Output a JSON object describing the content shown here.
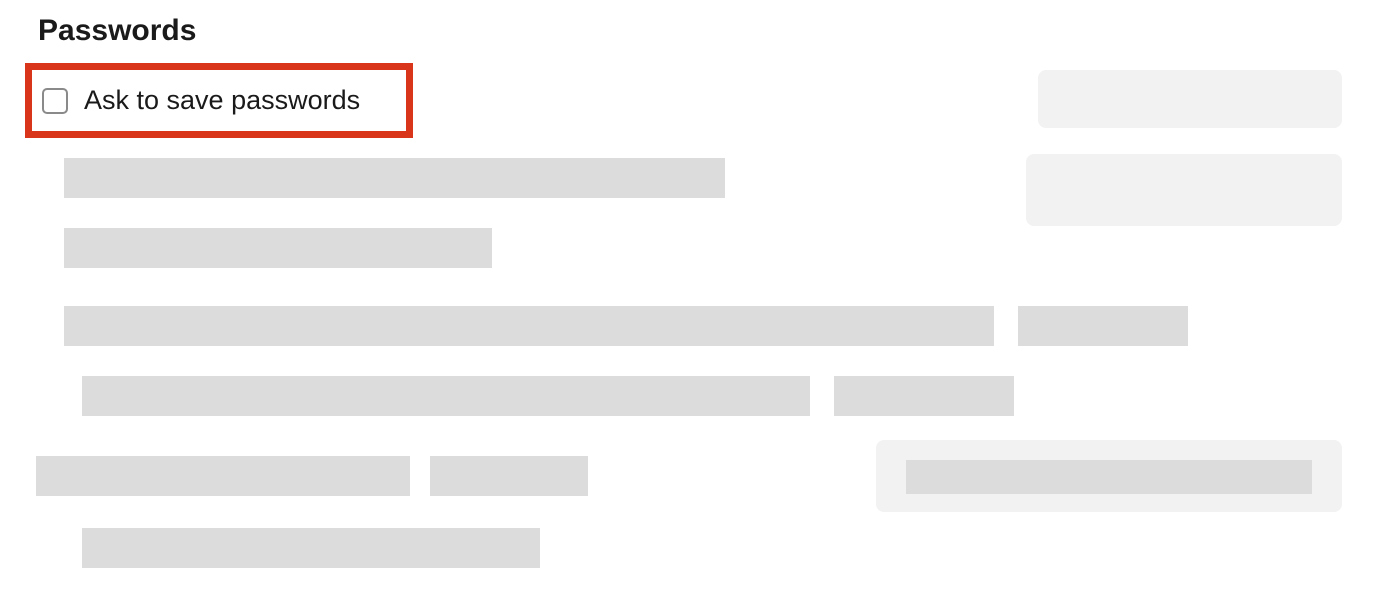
{
  "section": {
    "title": "Passwords"
  },
  "ask_to_save": {
    "label": "Ask to save passwords"
  }
}
